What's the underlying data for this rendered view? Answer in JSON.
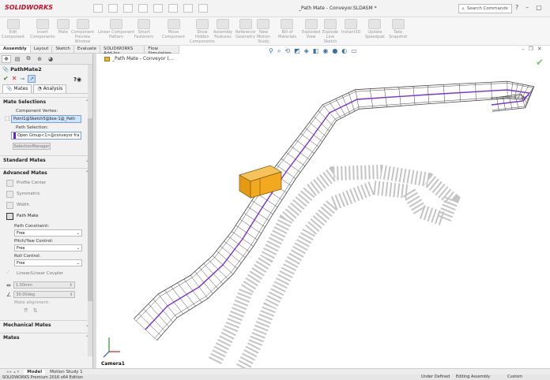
{
  "app": {
    "logo_text": "SOLIDWORKS",
    "doc_title": "_Path Mate - Conveyor.SLDASM *",
    "search_placeholder": "Search Commands",
    "search_icon": "search-icon",
    "window_controls": [
      "?",
      "–",
      "▢"
    ]
  },
  "ribbon": [
    {
      "label": "Edit\nComponent"
    },
    {
      "label": "Insert\nComponents"
    },
    {
      "label": "Mate"
    },
    {
      "label": "Component\nPreview\nWindow"
    },
    {
      "label": "Linear Component\nPattern"
    },
    {
      "label": "Smart\nFasteners"
    },
    {
      "label": "Move\nComponent"
    },
    {
      "label": "Show\nHidden\nComponents"
    },
    {
      "label": "Assembly\nFeatures"
    },
    {
      "label": "Reference\nGeometry"
    },
    {
      "label": "New\nMotion\nStudy"
    },
    {
      "label": "Bill of\nMaterials"
    },
    {
      "label": "Exploded\nView"
    },
    {
      "label": "Explode\nLine\nSketch"
    },
    {
      "label": "Instant3D"
    },
    {
      "label": "Update\nSpeedpak"
    },
    {
      "label": "Take\nSnapshot"
    }
  ],
  "command_tabs": [
    "Assembly",
    "Layout",
    "Sketch",
    "Evaluate",
    "SOLIDWORKS Add-Ins",
    "Flow Simulation"
  ],
  "active_command_tab": "Assembly",
  "feature_tree": {
    "item": "_Path Mate - Conveyor (..."
  },
  "property_manager": {
    "title": "PathMate2",
    "ok": "✔",
    "cancel": "✕",
    "subtabs": [
      "Mates",
      "Analysis"
    ],
    "mate_selections": {
      "heading": "Mate Selections",
      "component_vertex_label": "Component Vertex:",
      "component_vertex_value": "Point1@Sketch5@box-1@_Path",
      "path_selection_label": "Path Selection:",
      "path_selection_value": "Open Group<1>@conveyor fra",
      "selection_manager_button": "SelectionManager"
    },
    "standard_mates": "Standard Mates",
    "advanced_mates": {
      "heading": "Advanced Mates",
      "options": [
        "Profile Center",
        "Symmetric",
        "Width",
        "Path Mate"
      ],
      "active_option": "Path Mate",
      "path_constraint_label": "Path Constraint:",
      "path_constraint_value": "Free",
      "pitch_yaw_label": "Pitch/Yaw Control:",
      "pitch_yaw_value": "Free",
      "roll_control_label": "Roll Control:",
      "roll_control_value": "Free",
      "linear_coupler": "Linear/Linear Coupler",
      "distance_value": "1.00mm",
      "angle_value": "30.00deg",
      "mate_alignment_label": "Mate alignment:"
    },
    "mechanical_mates": "Mechanical Mates",
    "mates_heading": "Mates"
  },
  "viewport": {
    "camera_label": "Camera1",
    "colors": {
      "path": "#7a2ee0",
      "box": "#f2a81f",
      "frame": "#444444",
      "shadow": "#9c9c9c"
    }
  },
  "bottom_tabs": [
    "Model",
    "Motion Study 1"
  ],
  "active_bottom_tab": "Model",
  "status": {
    "edition": "SOLIDWORKS Premium 2016 x64 Edition",
    "state": "Under Defined",
    "mode": "Editing Assembly",
    "units": "Custom"
  }
}
